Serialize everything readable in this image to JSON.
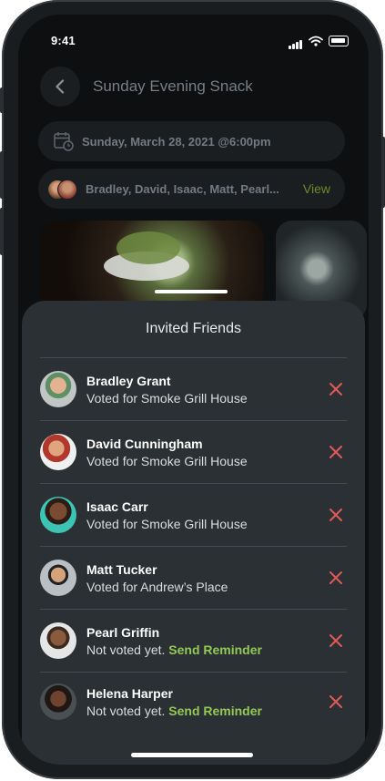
{
  "status_bar": {
    "time": "9:41"
  },
  "header": {
    "title": "Sunday Evening Snack"
  },
  "event": {
    "date_text": "Sunday, March 28, 2021 @6:00pm",
    "friends_text": "Bradley, David, Isaac, Matt, Pearl...",
    "view_label": "View"
  },
  "sheet": {
    "title": "Invited Friends",
    "friends": [
      {
        "name": "Bradley Grant",
        "status": "Voted for Smoke Grill House",
        "reminder": ""
      },
      {
        "name": "David Cunningham",
        "status": "Voted for Smoke Grill House",
        "reminder": ""
      },
      {
        "name": "Isaac Carr",
        "status": "Voted for Smoke Grill House",
        "reminder": ""
      },
      {
        "name": "Matt Tucker",
        "status": "Voted for Andrew’s Place",
        "reminder": ""
      },
      {
        "name": "Pearl Griffin",
        "status": "Not voted yet.",
        "reminder": "Send Reminder"
      },
      {
        "name": "Helena Harper",
        "status": "Not voted yet.",
        "reminder": "Send Reminder"
      }
    ]
  },
  "icons": {
    "back": "chevron-left-icon",
    "calendar": "calendar-clock-icon",
    "remove": "close-icon"
  },
  "colors": {
    "accent_green": "#93c957",
    "remove_red": "#e05a5a",
    "sheet_bg": "#2a3033"
  }
}
